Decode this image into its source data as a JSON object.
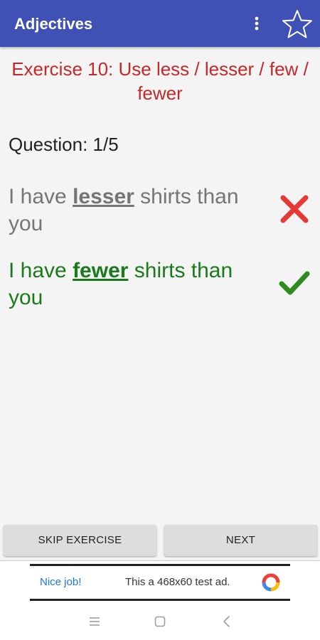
{
  "app": {
    "title": "Adjectives",
    "accent_color": "#3f51b5"
  },
  "exercise": {
    "title": "Exercise 10: Use less / lesser / few / fewer",
    "title_color": "#c62828",
    "question_label": "Question: 1/5"
  },
  "answers": [
    {
      "prefix": "I have ",
      "keyword": "lesser",
      "suffix": " shirts than you",
      "status": "wrong",
      "status_icon": "cross-icon",
      "color": "#757575"
    },
    {
      "prefix": "I have ",
      "keyword": "fewer",
      "suffix": " shirts than you",
      "status": "correct",
      "status_icon": "check-icon",
      "color": "#1b7a1b"
    }
  ],
  "buttons": {
    "skip_label": "SKIP EXERCISE",
    "next_label": "NEXT"
  },
  "ad": {
    "highlight": "Nice job!",
    "text": "This a 468x60 test ad.",
    "logo_icon": "ad-network-logo-icon"
  },
  "icons": {
    "overflow_menu": "more-vert-icon",
    "favorite": "star-outline-icon",
    "nav_recents": "menu-lines-icon",
    "nav_home": "square-home-icon",
    "nav_back": "chevron-left-icon"
  }
}
